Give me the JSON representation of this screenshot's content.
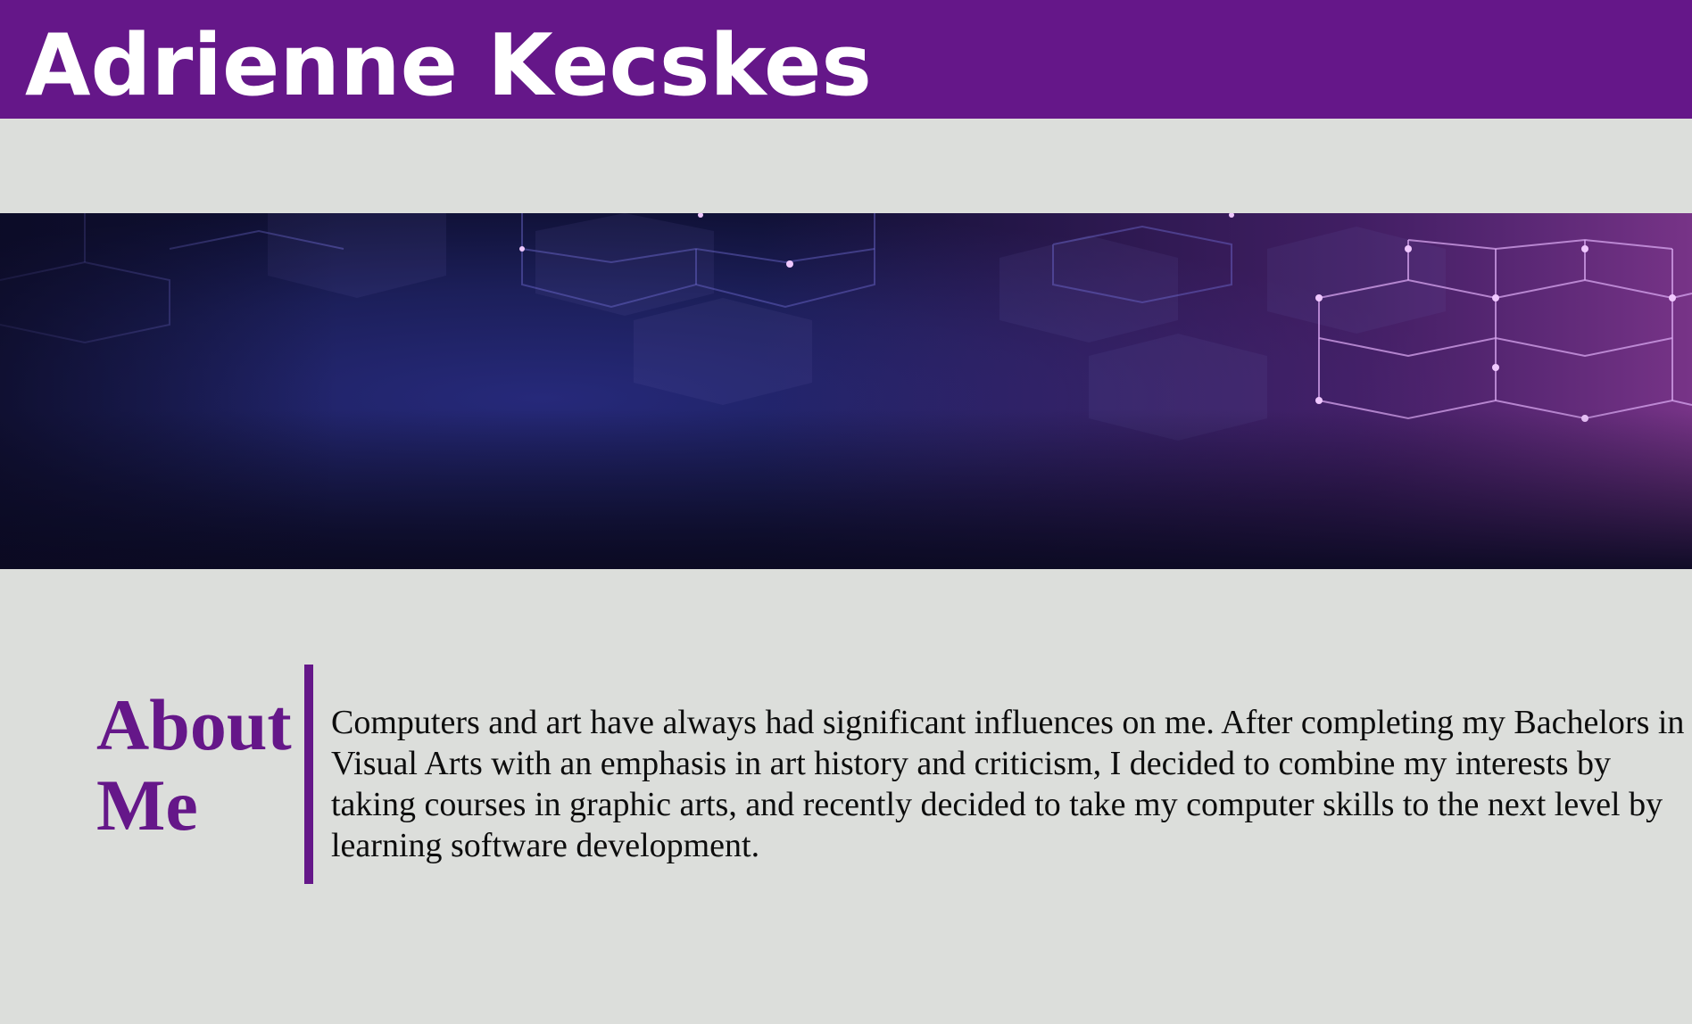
{
  "header": {
    "title": "Adrienne Kecskes"
  },
  "colors": {
    "accent": "#651789",
    "background": "#dcdedb",
    "header_text": "#ffffff",
    "body_text": "#0d0d0d"
  },
  "about": {
    "heading": "About Me",
    "paragraph": "Computers and art have always had significant influences on me. After completing my Bachelors in Visual Arts with an emphasis in art history and criticism, I decided to combine my interests by taking courses in graphic arts, and recently decided to take my computer skills to the next level by learning software development."
  }
}
